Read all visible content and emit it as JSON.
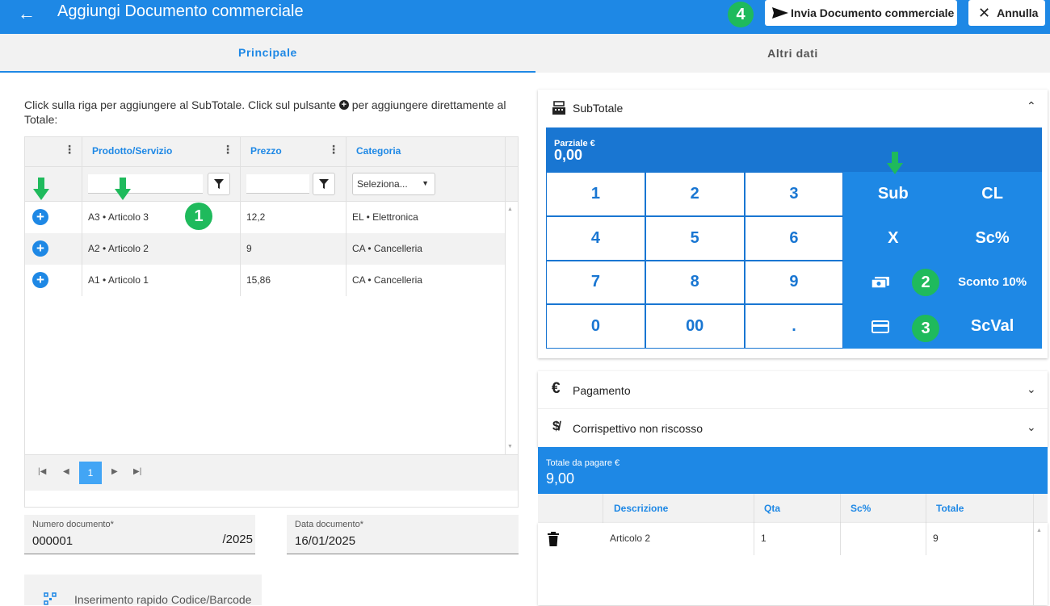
{
  "header": {
    "title": "Aggiungi Documento commerciale",
    "send_label": "Invia Documento commerciale",
    "cancel_label": "Annulla",
    "marker": "4"
  },
  "tabs": [
    "Principale",
    "Altri dati"
  ],
  "instructions": {
    "part1": "Click sulla riga per aggiungere al SubTotale. Click sul pulsante",
    "part2": "per aggiungere direttamente al Totale:"
  },
  "grid": {
    "columns": [
      "Prodotto/Servizio",
      "Prezzo",
      "Categoria"
    ],
    "category_filter_placeholder": "Seleziona...",
    "rows": [
      {
        "product": "A3 • Articolo 3",
        "price": "12,2",
        "category": "EL • Elettronica"
      },
      {
        "product": "A2 • Articolo 2",
        "price": "9",
        "category": "CA • Cancelleria"
      },
      {
        "product": "A1 • Articolo 1",
        "price": "15,86",
        "category": "CA • Cancelleria"
      }
    ],
    "marker": "1",
    "current_page": "1"
  },
  "form": {
    "number_label": "Numero documento*",
    "number_value": "000001",
    "number_suffix": "/2025",
    "date_label": "Data documento*",
    "date_value": "16/01/2025",
    "quick_insert_label": "Inserimento rapido Codice/Barcode"
  },
  "subtotal": {
    "title": "SubTotale",
    "partial_label": "Parziale €",
    "partial_value": "0,00",
    "keys": {
      "k1": "1",
      "k2": "2",
      "k3": "3",
      "sub": "Sub",
      "cl": "CL",
      "k4": "4",
      "k5": "5",
      "k6": "6",
      "x": "X",
      "sc_pct": "Sc%",
      "k7": "7",
      "k8": "8",
      "k9": "9",
      "sconto10": "Sconto 10%",
      "k0": "0",
      "k00": "00",
      "dot": ".",
      "scval": "ScVal"
    },
    "marker2": "2",
    "marker3": "3"
  },
  "payment": {
    "title": "Pagamento",
    "uncollected_title": "Corrispettivo non riscosso"
  },
  "total": {
    "label": "Totale da pagare €",
    "value": "9,00",
    "columns": [
      "Descrizione",
      "Qta",
      "Sc%",
      "Totale"
    ],
    "rows": [
      {
        "description": "Articolo 2",
        "qty": "1",
        "discount": "",
        "total": "9"
      }
    ]
  },
  "colors": {
    "primary": "#1e88e5",
    "keypad_dark": "#1976d2",
    "marker_green": "#1fba5c"
  }
}
